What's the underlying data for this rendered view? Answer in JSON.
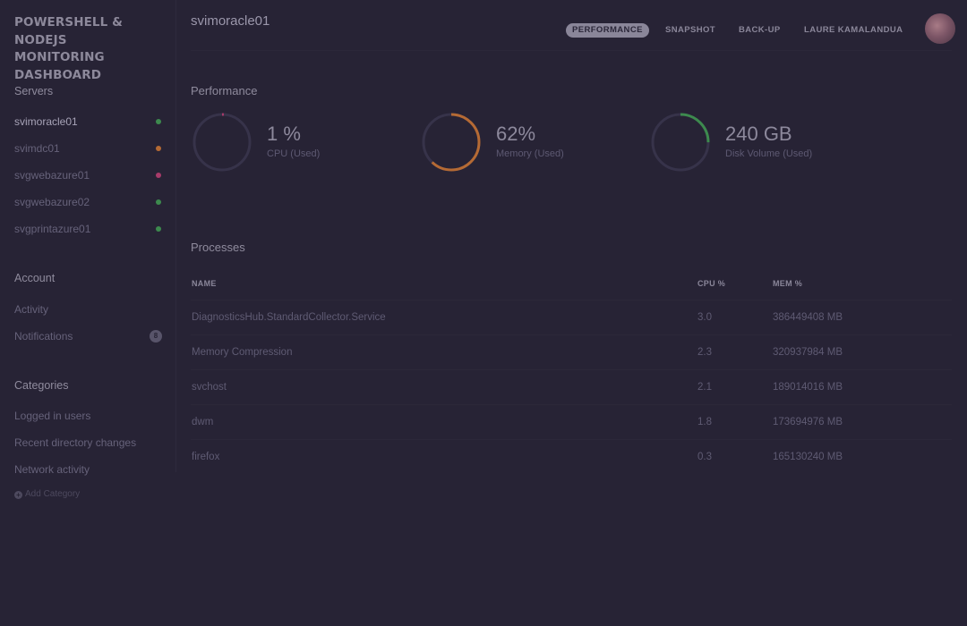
{
  "brand": {
    "line1": "POWERSHELL & NODEJS",
    "line2": "MONITORING",
    "line3": "DASHBOARD"
  },
  "sidebar": {
    "servers_title": "Servers",
    "servers": [
      {
        "name": "svimoracle01",
        "status_color": "#3d8a4e",
        "active": true
      },
      {
        "name": "svimdc01",
        "status_color": "#b56a34",
        "active": false
      },
      {
        "name": "svgwebazure01",
        "status_color": "#a83b6a",
        "active": false
      },
      {
        "name": "svgwebazure02",
        "status_color": "#3d8a4e",
        "active": false
      },
      {
        "name": "svgprintazure01",
        "status_color": "#3d8a4e",
        "active": false
      }
    ],
    "account_title": "Account",
    "account_items": [
      {
        "label": "Activity"
      },
      {
        "label": "Notifications",
        "badge": "8"
      }
    ],
    "categories_title": "Categories",
    "categories": [
      {
        "label": "Logged in users"
      },
      {
        "label": "Recent directory changes"
      },
      {
        "label": "Network activity"
      }
    ],
    "add_category_label": "Add Category",
    "add_category_icon": "plus-circle-icon"
  },
  "header": {
    "server_title": "svimoracle01",
    "nav": [
      {
        "label": "PERFORMANCE",
        "active": true
      },
      {
        "label": "SNAPSHOT",
        "active": false
      },
      {
        "label": "BACK-UP",
        "active": false
      },
      {
        "label": "LAURE KAMALANDUA",
        "active": false
      }
    ],
    "avatar_icon": "user-avatar"
  },
  "performance": {
    "title": "Performance",
    "metrics": [
      {
        "value": "1 %",
        "label": "CPU (Used)",
        "fraction": 0.01,
        "color": "#a83b6a"
      },
      {
        "value": "62%",
        "label": "Memory (Used)",
        "fraction": 0.62,
        "color": "#b56a34"
      },
      {
        "value": "240 GB",
        "label": "Disk Volume (Used)",
        "fraction": 0.25,
        "color": "#3d8a4e"
      }
    ],
    "track_color": "#37334a"
  },
  "processes": {
    "title": "Processes",
    "columns": [
      "NAME",
      "CPU %",
      "MEM %"
    ],
    "rows": [
      {
        "name": "DiagnosticsHub.StandardCollector.Service",
        "cpu": "3.0",
        "mem": "386449408 MB"
      },
      {
        "name": "Memory Compression",
        "cpu": "2.3",
        "mem": "320937984 MB"
      },
      {
        "name": "svchost",
        "cpu": "2.1",
        "mem": "189014016 MB"
      },
      {
        "name": "dwm",
        "cpu": "1.8",
        "mem": "173694976 MB"
      },
      {
        "name": "firefox",
        "cpu": "0.3",
        "mem": "165130240 MB"
      }
    ]
  }
}
